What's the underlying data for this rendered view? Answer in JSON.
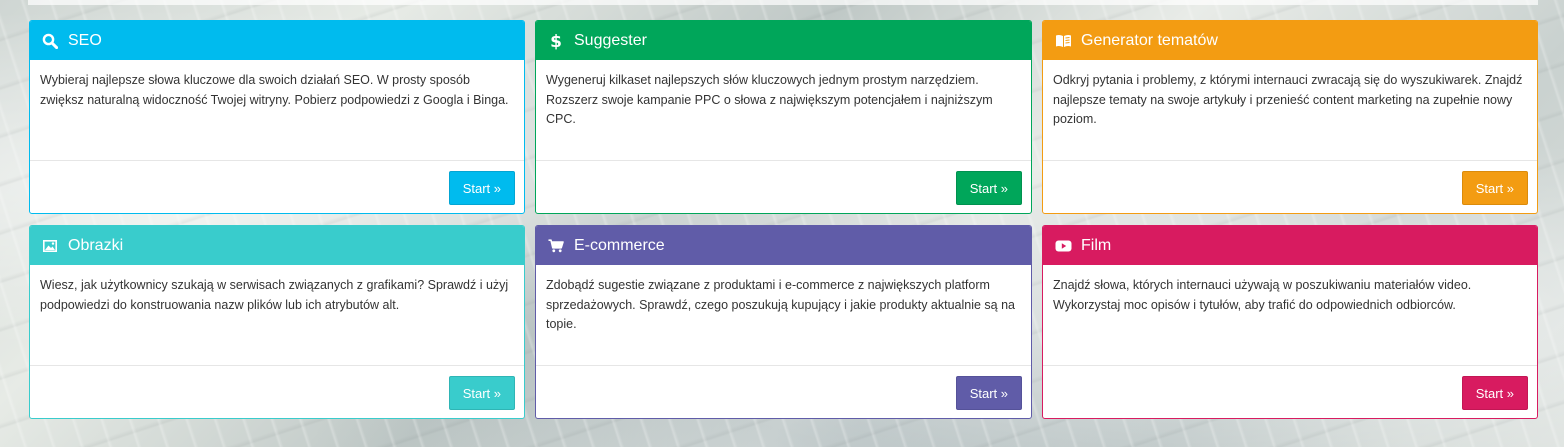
{
  "cards": [
    {
      "title": "SEO",
      "icon": "search-icon",
      "color": "#00bbee",
      "color_dark": "#03a5d3",
      "description": "Wybieraj najlepsze słowa kluczowe dla swoich działań SEO. W prosty sposób zwiększ naturalną widoczność Twojej witryny. Pobierz podpowiedzi z Googla i Binga.",
      "button_label": "Start »"
    },
    {
      "title": "Suggester",
      "icon": "dollar-icon",
      "color": "#00a65a",
      "color_dark": "#00914f",
      "description": "Wygeneruj kilkaset najlepszych słów kluczowych jednym prostym narzędziem. Rozszerz swoje kampanie PPC o słowa z największym potencjałem i najniższym CPC.",
      "button_label": "Start »"
    },
    {
      "title": "Generator tematów",
      "icon": "book-icon",
      "color": "#f39c12",
      "color_dark": "#db8b0b",
      "description": "Odkryj pytania i problemy, z którymi internauci zwracają się do wyszukiwarek. Znajdź najlepsze tematy na swoje artykuły i przenieść content marketing na zupełnie nowy poziom.",
      "button_label": "Start »"
    },
    {
      "title": "Obrazki",
      "icon": "image-icon",
      "color": "#39cccc",
      "color_dark": "#2fb5b5",
      "description": "Wiesz, jak użytkownicy szukają w serwisach związanych z grafikami? Sprawdź i użyj podpowiedzi do konstruowania nazw plików lub ich atrybutów alt.",
      "button_label": "Start »"
    },
    {
      "title": "E-commerce",
      "icon": "cart-icon",
      "color": "#605ca8",
      "color_dark": "#555299",
      "description": "Zdobądź sugestie związane z produktami i e-commerce z największych platform sprzedażowych. Sprawdź, czego poszukują kupujący i jakie produkty aktualnie są na topie.",
      "button_label": "Start »"
    },
    {
      "title": "Film",
      "icon": "youtube-icon",
      "color": "#d81b60",
      "color_dark": "#c21754",
      "description": "Znajdź słowa, których internauci używają w poszukiwaniu materiałów video. Wykorzystaj moc opisów i tytułów, aby trafić do odpowiednich odbiorców.",
      "button_label": "Start »"
    }
  ]
}
